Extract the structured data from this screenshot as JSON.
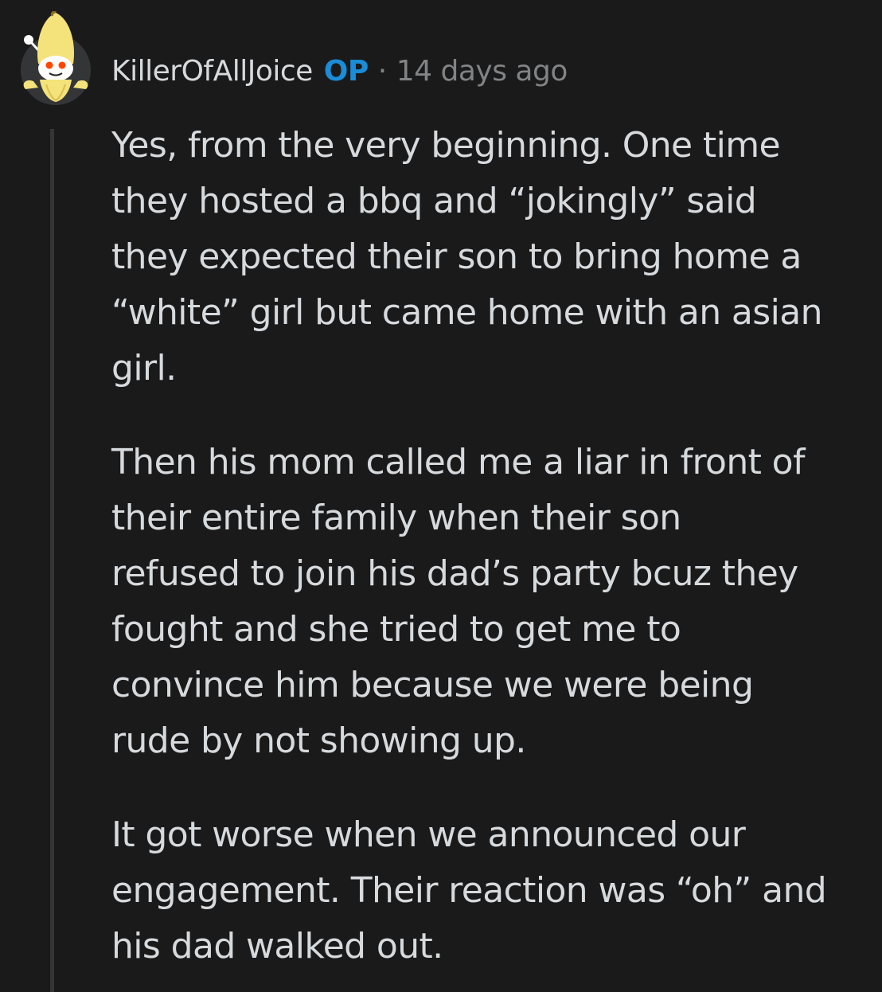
{
  "comment": {
    "author": "KillerOfAllJoice",
    "op_badge": "OP",
    "separator": "·",
    "timestamp": "14 days ago",
    "avatar_icon": "snoo-banana-avatar-icon",
    "paragraphs": [
      "Yes, from the very beginning. One time\nthey hosted a bbq and “jokingly” said\nthey expected their son to bring home a\n“white” girl but came home with an asian\ngirl.",
      "Then his mom called me a liar in front of\ntheir entire family when their son\nrefused to join his dad’s party bcuz they\nfought and she tried to get me to\nconvince him because we were being\nrude by not showing up.",
      "It got worse when we announced our\nengagement. Their reaction was “oh” and\nhis dad walked out."
    ]
  },
  "colors": {
    "background": "#1a1a1b",
    "text": "#d7dadc",
    "muted": "#818384",
    "op_badge": "#1a8cd8",
    "thread_line": "#343536"
  }
}
